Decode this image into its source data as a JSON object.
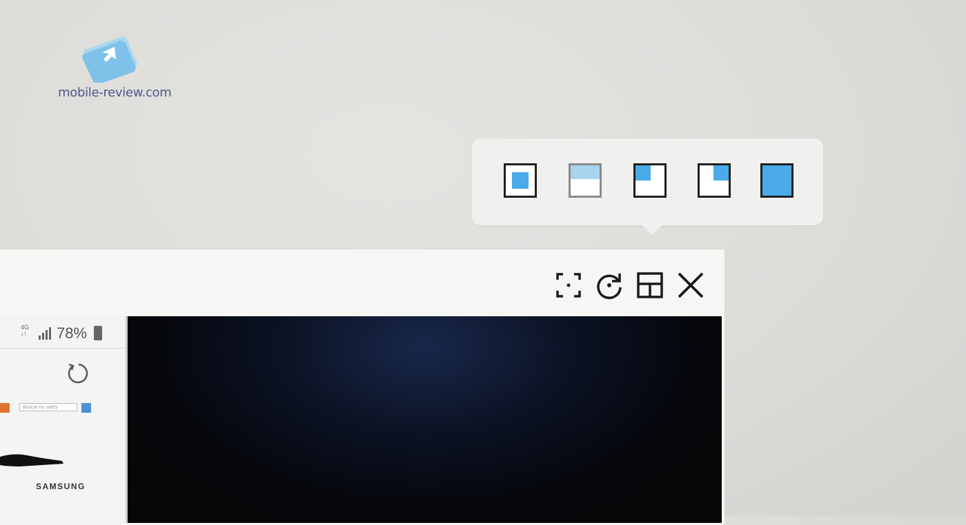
{
  "watermark": {
    "text": "mobile-review.com"
  },
  "layout_popup": {
    "options": [
      {
        "name": "center"
      },
      {
        "name": "top-half"
      },
      {
        "name": "top-left"
      },
      {
        "name": "top-right"
      },
      {
        "name": "full"
      }
    ],
    "accent_color": "#4aabe8"
  },
  "window": {
    "toolbar": {
      "buttons": [
        "capture-icon",
        "rotate-icon",
        "layout-icon",
        "close-icon"
      ]
    },
    "phone": {
      "network": "4G",
      "battery_percent": "78%",
      "address_placeholder": "Buscar no sattry",
      "brand": "SAMSUNG"
    }
  }
}
